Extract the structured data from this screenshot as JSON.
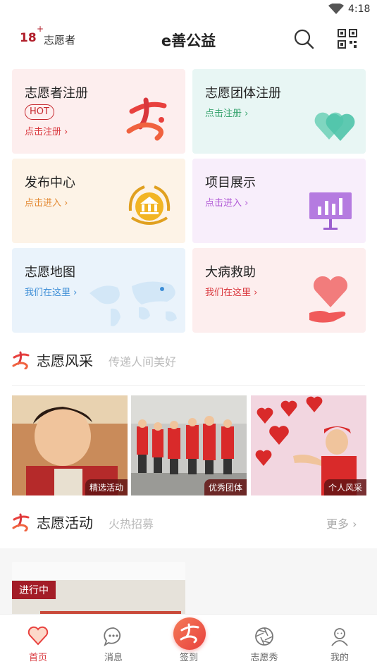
{
  "status_bar": {
    "time": "4:18"
  },
  "header": {
    "volunteer_count": "18",
    "count_plus": "+",
    "volunteer_label": "志愿者",
    "app_title": "e善公益"
  },
  "cards": [
    {
      "title": "志愿者注册",
      "badge": "HOT",
      "subtitle": "点击注册 ›",
      "subtitle_color": "#d9373d",
      "bg": "#fdeeee"
    },
    {
      "title": "志愿团体注册",
      "subtitle": "点击注册 ›",
      "subtitle_color": "#3aa570",
      "bg": "#e8f6f4"
    },
    {
      "title": "发布中心",
      "subtitle": "点击进入 ›",
      "subtitle_color": "#e38a34",
      "bg": "#fdf3e7"
    },
    {
      "title": "项目展示",
      "subtitle": "点击进入 ›",
      "subtitle_color": "#b15ad6",
      "bg": "#f8eefb"
    },
    {
      "title": "志愿地图",
      "subtitle": "我们在这里 ›",
      "subtitle_color": "#3c8dd6",
      "bg": "#eaf3fb"
    },
    {
      "title": "大病救助",
      "subtitle": "我们在这里 ›",
      "subtitle_color": "#d9373d",
      "bg": "#fdeeee"
    }
  ],
  "section_style": {
    "title": "志愿风采",
    "subtitle": "传递人间美好"
  },
  "photos": [
    {
      "tag": "精选活动"
    },
    {
      "tag": "优秀团体"
    },
    {
      "tag": "个人风采"
    }
  ],
  "section_activity": {
    "title": "志愿活动",
    "subtitle": "火热招募",
    "more": "更多 ›"
  },
  "activity_card": {
    "status": "进行中"
  },
  "tabbar": {
    "items": [
      {
        "label": "首页",
        "icon": "heart-icon",
        "active": true
      },
      {
        "label": "消息",
        "icon": "chat-icon",
        "active": false
      },
      {
        "label": "签到",
        "icon": "signin-icon",
        "active": false
      },
      {
        "label": "志愿秀",
        "icon": "aperture-icon",
        "active": false
      },
      {
        "label": "我的",
        "icon": "user-icon",
        "active": false
      }
    ]
  },
  "colors": {
    "brand": "#d9373d",
    "accent_dark": "#a31d27"
  }
}
